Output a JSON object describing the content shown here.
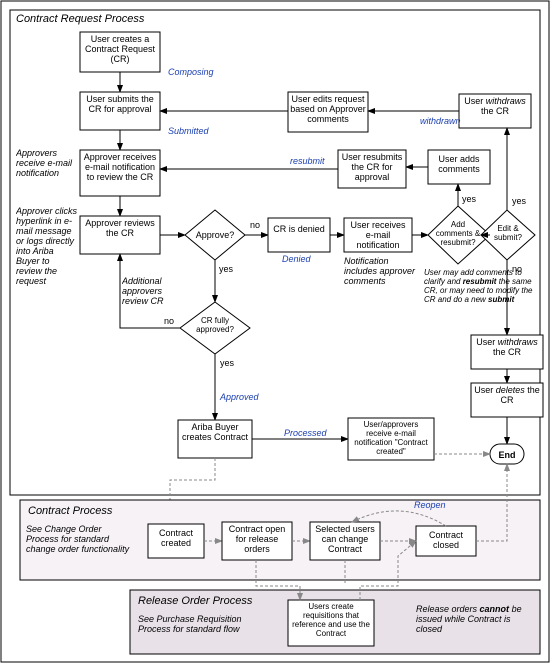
{
  "panels": {
    "crp_title": "Contract Request Process",
    "cp_title": "Contract Process",
    "rop_title": "Release Order Process"
  },
  "nodes": {
    "n_create": "User creates a Contract Request (CR)",
    "n_submit": "User submits the CR for approval",
    "n_notify": "Approver receives e-mail notification to review the CR",
    "n_review": "Approver reviews the CR",
    "d_approve": "Approve?",
    "d_full": "CR fully approved?",
    "n_denied": "CR is denied",
    "n_usernote": "User receives e-mail notification",
    "d_addcomm": "Add comments & resubmit?",
    "n_addc": "User adds comments",
    "n_resub": "User resubmits the CR for approval",
    "n_edit": "User edits request based on Approver comments",
    "n_withdraw1": "User withdraws the CR",
    "d_editsub": "Edit & submit?",
    "n_withdraw2": "User withdraws the CR",
    "n_delete": "User deletes the CR",
    "n_end": "End",
    "n_ariba": "Ariba Buyer creates Contract",
    "n_cnotify": "User/approvers receive e-mail notification \"Contract created\"",
    "n_ccreated": "Contract created",
    "n_copen": "Contract open for release orders",
    "n_cchange": "Selected users can change Contract",
    "n_cclosed": "Contract closed",
    "n_rop": "Users create requisitions that reference and use the Contract"
  },
  "labels": {
    "composing": "Composing",
    "submitted": "Submitted",
    "resubmit": "resubmit",
    "withdrawn": "withdrawn",
    "denied": "Denied",
    "approved": "Approved",
    "processed": "Processed",
    "reopen": "Reopen",
    "yes": "yes",
    "no": "no"
  },
  "notes": {
    "note_left1": "Approvers receive e-mail notification",
    "note_left2": "Approver clicks hyperlink in e-mail message or logs directly into Ariba Buyer to review the request",
    "note_mid": "Notification includes approver comments",
    "note_right_b1": "User may add comments to clarify and ",
    "note_right_b1b": "resubmit",
    "note_right_b2": " the same CR, or may need to modify the CR and do a new ",
    "note_right_b2b": "submit",
    "note_addrev": "Additional approvers review CR",
    "note_cp": "See Change Order Process for standard change order functionality",
    "note_rop": "See Purchase Requisition Process for standard flow",
    "note_ro_b1": "Release orders ",
    "note_ro_b2": "cannot",
    "note_ro_b3": " be issued while Contract is closed"
  }
}
